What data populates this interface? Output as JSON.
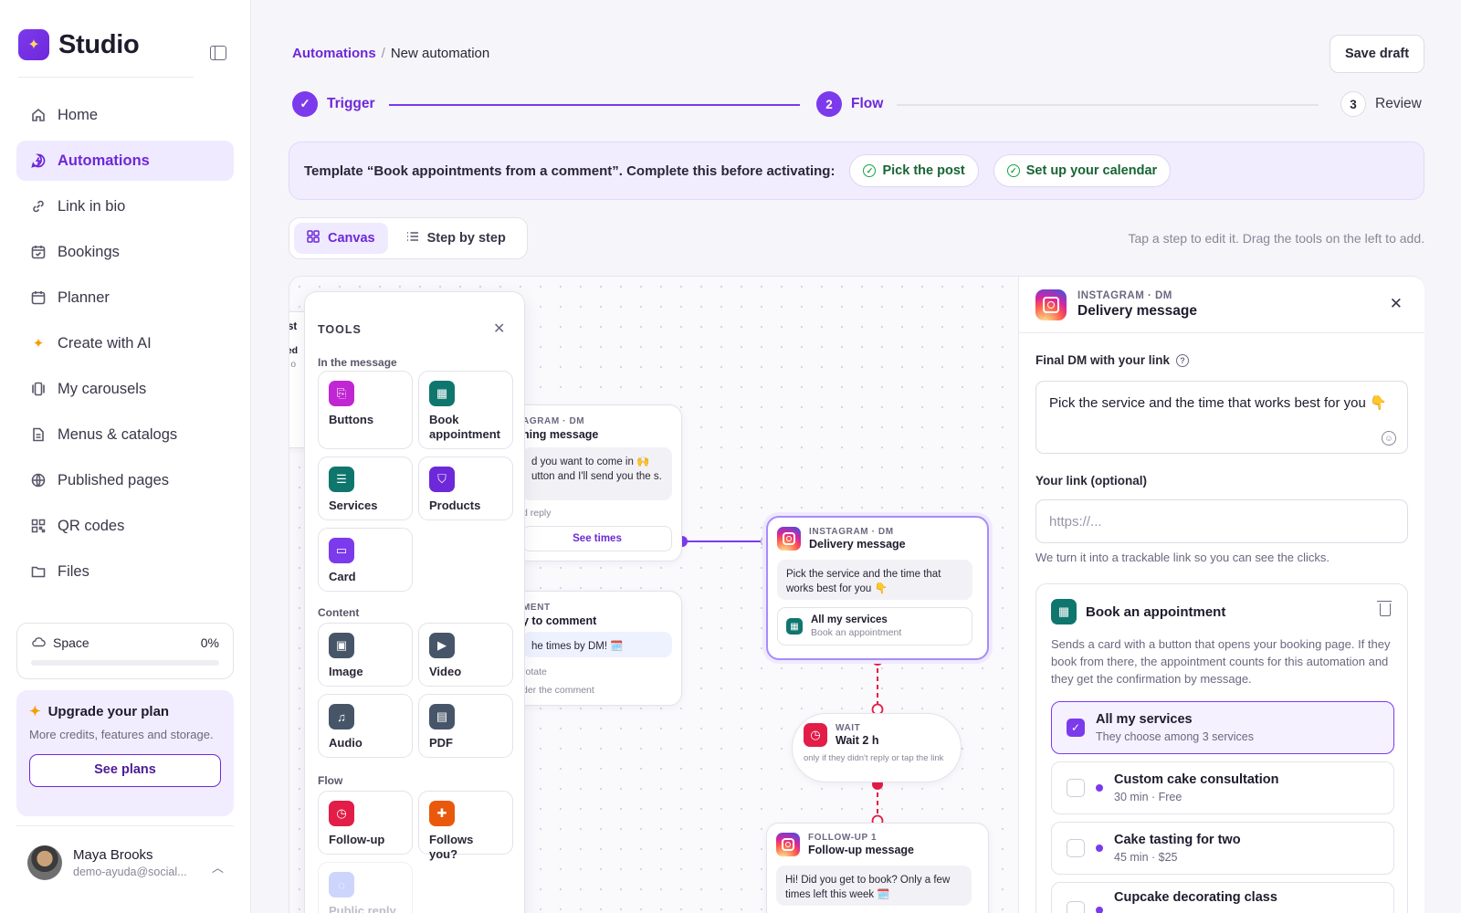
{
  "sidebar": {
    "brand": "Studio",
    "items": [
      {
        "label": "Home",
        "icon": "home-icon"
      },
      {
        "label": "Automations",
        "icon": "chat-bolt-icon",
        "active": true
      },
      {
        "label": "Link in bio",
        "icon": "link-icon"
      },
      {
        "label": "Bookings",
        "icon": "calendar-check-icon"
      },
      {
        "label": "Planner",
        "icon": "calendar-icon"
      },
      {
        "label": "Create with AI",
        "icon": "sparkle-icon"
      },
      {
        "label": "My carousels",
        "icon": "carousel-icon"
      },
      {
        "label": "Menus & catalogs",
        "icon": "document-icon"
      },
      {
        "label": "Published pages",
        "icon": "globe-icon"
      },
      {
        "label": "QR codes",
        "icon": "qr-icon"
      },
      {
        "label": "Files",
        "icon": "folder-icon"
      }
    ],
    "space": {
      "label": "Space",
      "value": "0%",
      "fraction": 0
    },
    "upgrade": {
      "title": "Upgrade your plan",
      "subtitle": "More credits, features and storage.",
      "button": "See plans"
    },
    "user": {
      "name": "Maya Brooks",
      "email": "demo-ayuda@social..."
    }
  },
  "header": {
    "breadcrumb": {
      "parent": "Automations",
      "separator": "/",
      "current": "New automation"
    },
    "save_label": "Save draft"
  },
  "stepper": {
    "steps": [
      {
        "number": "✓",
        "label": "Trigger",
        "state": "done"
      },
      {
        "number": "2",
        "label": "Flow",
        "state": "current"
      },
      {
        "number": "3",
        "label": "Review",
        "state": "todo"
      }
    ]
  },
  "banner": {
    "text": "Template “Book appointments from a comment”. Complete this before activating:",
    "chips": [
      "Pick the post",
      "Set up your calendar"
    ]
  },
  "view_toggle": {
    "canvas": "Canvas",
    "steps": "Step by step"
  },
  "hint": "Tap a step to edit it. Drag the tools on the left to add.",
  "tools": {
    "title": "TOOLS",
    "sections": {
      "message": "In the message",
      "content": "Content",
      "flow": "Flow"
    },
    "items": [
      {
        "label": "Buttons",
        "color": "#c026d3"
      },
      {
        "label": "Book appointment",
        "color": "#0f766e"
      },
      {
        "label": "Services",
        "color": "#0f766e"
      },
      {
        "label": "Products",
        "color": "#6d28d9"
      },
      {
        "label": "Card",
        "color": "#7c3aed"
      },
      {
        "label": "Image",
        "color": "#475569"
      },
      {
        "label": "Video",
        "color": "#475569"
      },
      {
        "label": "Audio",
        "color": "#475569"
      },
      {
        "label": "PDF",
        "color": "#475569"
      },
      {
        "label": "Follow-up",
        "color": "#e11d48"
      },
      {
        "label": "Follows you?",
        "color": "#ea580c"
      },
      {
        "label": "Public reply",
        "color": "#a5b4fc"
      }
    ]
  },
  "canvas": {
    "partial_post": {
      "title": "ost",
      "l1": "ked",
      "l2": "ts o"
    },
    "opening": {
      "kind": "AGRAM · DM",
      "title": "ning message",
      "body": "d you want to come in 🙌 utton and I'll send you the s.",
      "meta": "d reply",
      "button": "See times"
    },
    "reply": {
      "kind": "MENT",
      "title": "y to comment",
      "body": "he times by DM! 🗓️",
      "meta1": "rotate",
      "meta2": "der the comment"
    },
    "delivery": {
      "kind": "INSTAGRAM · DM",
      "title": "Delivery message",
      "body": "Pick the service and the time that works best for you 👇",
      "service_title": "All my services",
      "service_sub": "Book an appointment"
    },
    "wait": {
      "kind": "WAIT",
      "title": "Wait 2 h",
      "sub": "only if they didn't reply or tap the link"
    },
    "followup": {
      "kind": "FOLLOW-UP 1",
      "title": "Follow-up message",
      "body": "Hi! Did you get to book? Only a few times left this week 🗓️"
    }
  },
  "panel": {
    "kind": "INSTAGRAM · DM",
    "title": "Delivery message",
    "dm_label": "Final DM with your link",
    "dm_text": "Pick the service and the time that works best for you 👇",
    "link_label": "Your link (optional)",
    "link_placeholder": "https://...",
    "link_note": "We turn it into a trackable link so you can see the clicks.",
    "booking": {
      "title": "Book an appointment",
      "description": "Sends a card with a button that opens your booking page. If they book from there, the appointment counts for this automation and they get the confirmation by message.",
      "options": [
        {
          "name": "All my services",
          "sub": "They choose among 3 services",
          "checked": true
        },
        {
          "name": "Custom cake consultation",
          "sub": "30 min · Free",
          "checked": false
        },
        {
          "name": "Cake tasting for two",
          "sub": "45 min · $25",
          "checked": false
        },
        {
          "name": "Cupcake decorating class",
          "sub": "",
          "checked": false
        }
      ]
    }
  },
  "colors": {
    "accent": "#7c3aed",
    "accent_dark": "#6d28d9",
    "success": "#16a34a",
    "danger": "#e11d48"
  }
}
